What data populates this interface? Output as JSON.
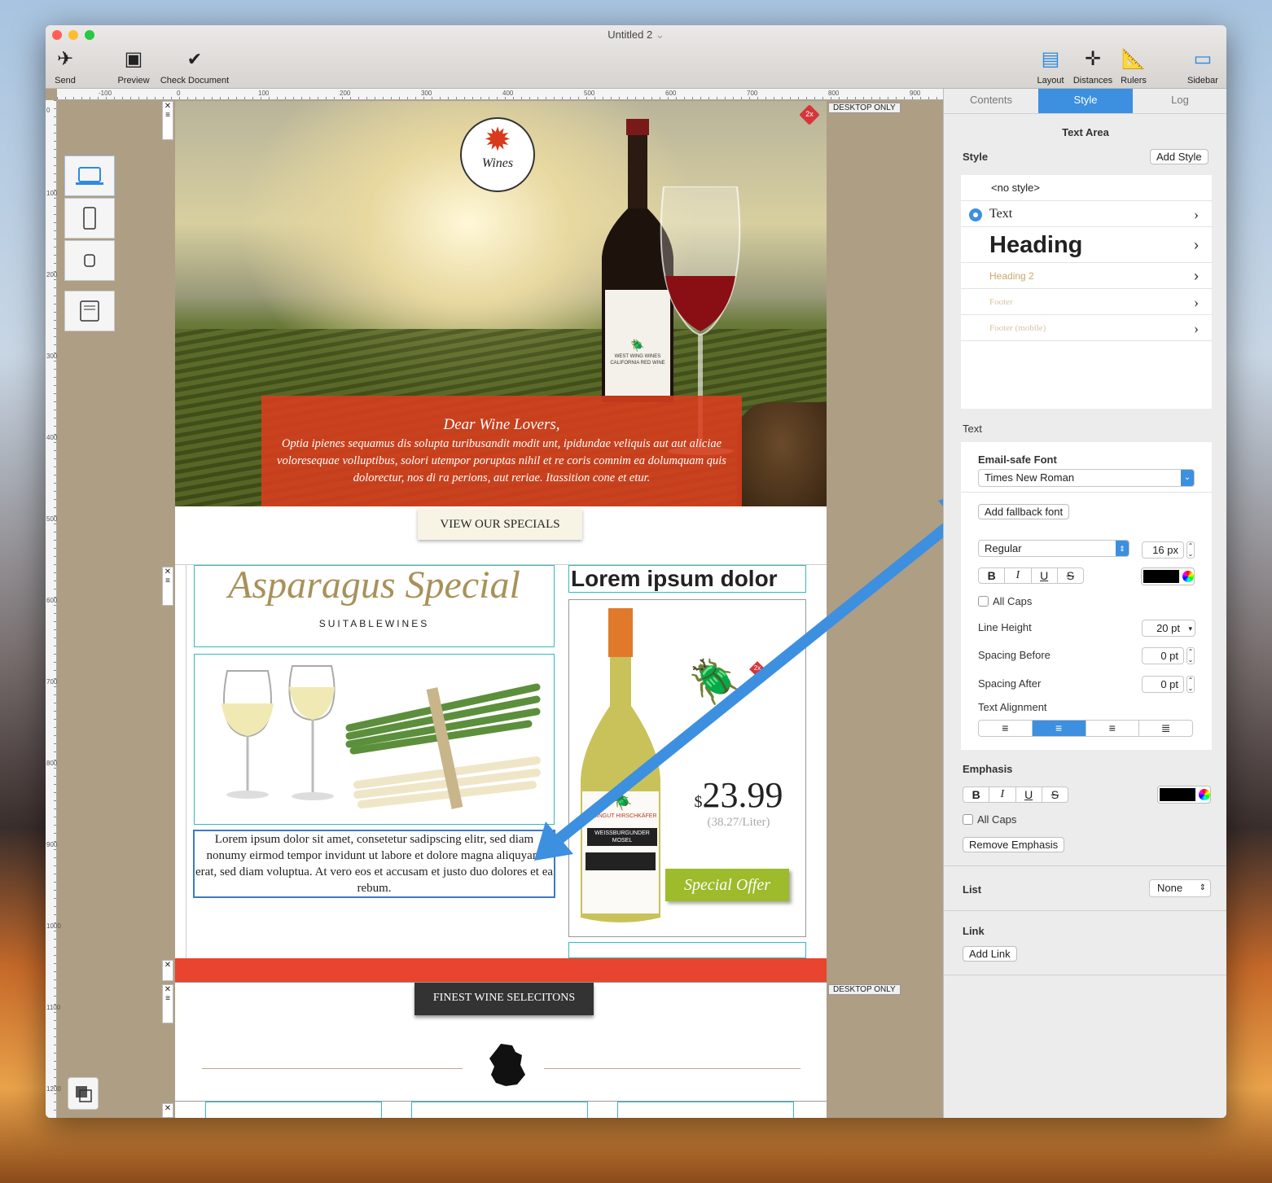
{
  "window": {
    "title": "Untitled 2",
    "title_chevron": "⌄"
  },
  "toolbar": {
    "left": [
      {
        "label": "Send",
        "icon": "paper-plane-icon"
      },
      {
        "label": "Preview",
        "icon": "devices-icon"
      },
      {
        "label": "Check Document",
        "icon": "checkmark-circle-icon"
      }
    ],
    "right": [
      {
        "label": "Layout",
        "icon": "layout-icon"
      },
      {
        "label": "Distances",
        "icon": "distances-icon"
      },
      {
        "label": "Rulers",
        "icon": "rulers-icon"
      },
      {
        "label": "Sidebar",
        "icon": "sidebar-icon"
      }
    ]
  },
  "ruler": {
    "h": [
      "-100",
      "0",
      "100",
      "200",
      "300",
      "400",
      "500",
      "600",
      "700",
      "800",
      "900"
    ],
    "v": [
      "0",
      "100",
      "200",
      "300",
      "400",
      "500",
      "600",
      "700",
      "800",
      "900",
      "1000",
      "1100",
      "1200"
    ]
  },
  "canvas": {
    "desktop_only_1": "DESKTOP ONLY",
    "desktop_only_2": "DESKTOP ONLY",
    "badge_2x": "2x",
    "badge_2x_b": "2x"
  },
  "email": {
    "logo_text": "Wines",
    "bottle_label": "WEST WING WINES",
    "bottle_sub": "CALIFORNIA RED WINE",
    "greeting": "Dear Wine Lovers,",
    "intro": "Optia ipienes sequamus dis solupta turibusandit modit unt, ipidundae veliquis aut aut aliciae voloresequae volluptibus, solori utempor poruptas nihil et re coris comnim ea dolumquam quis dolorectur, nos di ra perions, aut reriae. Itassition cone et etur.",
    "specials_button": "VIEW OUR SPECIALS",
    "asparagus_title": "Asparagus Special",
    "asparagus_sub": "SUITABLEWINES",
    "lorem_heading": "Lorem ipsum dolor",
    "body_text": "Lorem ipsum dolor sit amet, consetetur sadipscing elitr, sed diam nonumy eirmod tempor invidunt ut labore et dolore magna aliquyam erat, sed diam voluptua. At vero eos et accusam et justo duo dolores et ea rebum.",
    "price_currency": "$",
    "price": "23.99",
    "price_per_liter": "(38.27/Liter)",
    "special_offer": "Special Offer",
    "white_bottle_label": "WEINGUT HIRSCHKÄFER",
    "white_bottle_sub": "WEISSBURGUNDER MOSEL",
    "finest_button": "FINEST WINE SELECITONS"
  },
  "sidebar": {
    "tabs": [
      "Contents",
      "Style",
      "Log"
    ],
    "active_tab": "Style",
    "section_title": "Text Area",
    "style_label": "Style",
    "add_style": "Add Style",
    "styles": [
      "<no style>",
      "Text",
      "Heading",
      "Heading 2",
      "Footer",
      "Footer (mobile)"
    ],
    "text_label": "Text",
    "email_safe_font_label": "Email-safe Font",
    "font_value": "Times New Roman",
    "add_fallback": "Add fallback font",
    "weight": "Regular",
    "size": "16 px",
    "fmt": [
      "B",
      "I",
      "U",
      "S"
    ],
    "all_caps": "All Caps",
    "line_height_label": "Line Height",
    "line_height": "20 pt",
    "spacing_before_label": "Spacing Before",
    "spacing_before": "0 pt",
    "spacing_after_label": "Spacing After",
    "spacing_after": "0 pt",
    "alignment_label": "Text Alignment",
    "emphasis_label": "Emphasis",
    "emphasis_all_caps": "All Caps",
    "remove_emphasis": "Remove Emphasis",
    "list_label": "List",
    "list_value": "None",
    "link_label": "Link",
    "add_link": "Add Link"
  },
  "colors": {
    "accent": "#3d8fe0",
    "red_banner": "#e84430",
    "teal_outline": "#33b5b5",
    "gold": "#a8915a",
    "green_button": "#9dbb2a"
  }
}
